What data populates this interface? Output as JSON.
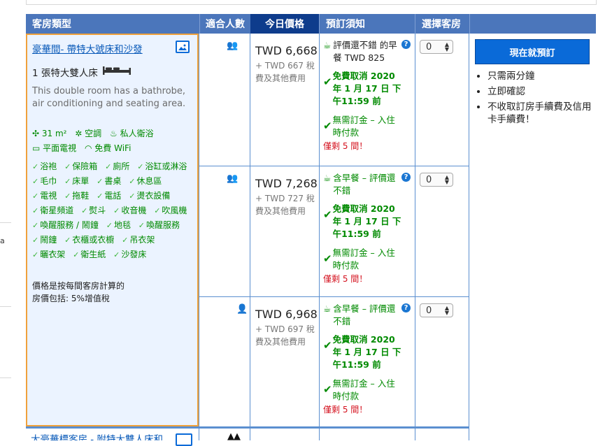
{
  "header": {
    "room_type": "客房類型",
    "guests": "適合人數",
    "today_price": "今日價格",
    "booking_info": "預訂須知",
    "select_rooms": "選擇客房"
  },
  "room": {
    "name": "豪華間- 帶特大號床和沙發",
    "bed": "1 張特大雙人床",
    "description": "This double room has a bathrobe, air conditioning and seating area.",
    "facilities": [
      "31 m²",
      "空調",
      "私人衛浴",
      "平面電視",
      "免費 WiFi"
    ],
    "amenities": [
      "浴袍",
      "保險箱",
      "廁所",
      "浴缸或淋浴",
      "毛巾",
      "床單",
      "書桌",
      "休息區",
      "電視",
      "拖鞋",
      "電話",
      "燙衣設備",
      "衛星頻道",
      "熨斗",
      "收音機",
      "吹風機",
      "喚醒服務 / 鬧鐘",
      "地毯",
      "喚醒服務",
      "鬧鐘",
      "衣櫃或衣櫥",
      "吊衣架",
      "曬衣架",
      "衛生紙",
      "沙發床"
    ],
    "price_note": "價格是按每間客房計算的",
    "price_includes": "房價包括: 5%增值稅",
    "next_room_partial": "大豪華標客房 - 附特大雙人床和"
  },
  "options": [
    {
      "guests": 2,
      "price": "TWD 6,668",
      "tax_1": "+ TWD 667 稅",
      "tax_2": "費及其他費用",
      "meal_1": "評價還不錯 的早",
      "meal_2": "餐 TWD 825",
      "cancel_1": "免費取消 2020",
      "cancel_2": "年 1 月 17 日 下",
      "cancel_3": "午11:59 前",
      "prepay_1": "無需訂金 – 入住",
      "prepay_2": "時付款",
      "left": "僅剩 5 間！",
      "qty": "0"
    },
    {
      "guests": 2,
      "price": "TWD 7,268",
      "tax_1": "+ TWD 727 稅",
      "tax_2": "費及其他費用",
      "meal_1": "含早餐 – 評價還",
      "meal_2": "不錯",
      "cancel_1": "免費取消 2020",
      "cancel_2": "年 1 月 17 日 下",
      "cancel_3": "午11:59 前",
      "prepay_1": "無需訂金 – 入住",
      "prepay_2": "時付款",
      "left": "僅剩 5 間！",
      "qty": "0"
    },
    {
      "guests": 1,
      "price": "TWD 6,968",
      "tax_1": "+ TWD 697 稅",
      "tax_2": "費及其他費用",
      "meal_1": "含早餐 – 評價還",
      "meal_2": "不錯",
      "cancel_1": "免費取消 2020",
      "cancel_2": "年 1 月 17 日 下",
      "cancel_3": "午11:59 前",
      "prepay_1": "無需訂金 – 入住",
      "prepay_2": "時付款",
      "left": "僅剩 5 間！",
      "qty": "0"
    }
  ],
  "booking": {
    "button": "現在就預訂",
    "benefits": [
      "只需兩分鐘",
      "立即確認",
      "不收取訂房手續費及信用卡手續費！"
    ]
  },
  "colors": {
    "header": "#4b76bb",
    "today_header": "#0e3c8c",
    "room_bg": "#ebf3ff",
    "green": "#008a00",
    "red": "#d4111e",
    "button": "#0a6ad8"
  }
}
